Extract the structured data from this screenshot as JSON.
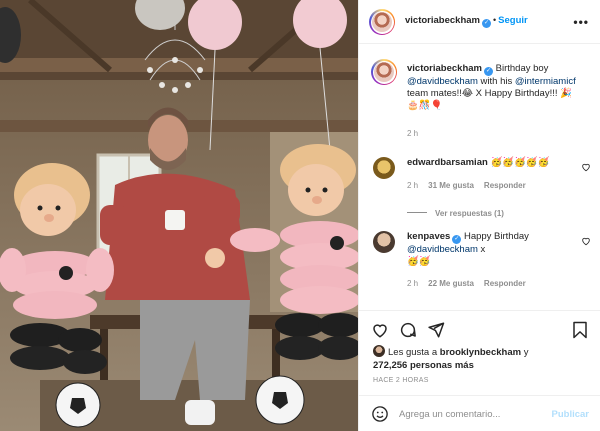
{
  "header": {
    "username": "victoriabeckham",
    "separator": "•",
    "follow_label": "Seguir",
    "more_label": "•••"
  },
  "caption": {
    "username": "victoriabeckham",
    "text_1": "Birthday boy",
    "mention_1": "@davidbeckham",
    "text_2": "with his",
    "mention_2": "@intermiamicf",
    "text_3": "team mates!!😂 X Happy Birthday!!! 🎉🎂🎊🎈",
    "time": "2 h"
  },
  "comments": [
    {
      "username": "edwardbarsamian",
      "text": "🥳🥳🥳🥳🥳",
      "time": "2 h",
      "likes": "31 Me gusta",
      "reply": "Responder",
      "view_replies": "Ver respuestas (1)"
    },
    {
      "username": "kenpaves",
      "text": "Happy Birthday",
      "mention": "@davidbeckham",
      "text_after": "x",
      "text_2": "🥳🥳",
      "time": "2 h",
      "likes": "22 Me gusta",
      "reply": "Responder"
    }
  ],
  "likes": {
    "prefix": "Les gusta a",
    "user": "brooklynbeckham",
    "and": "y",
    "count": "272,256 personas más"
  },
  "timestamp": "HACE 2 HORAS",
  "add_comment": {
    "placeholder": "Agrega un comentario...",
    "publish": "Publicar"
  },
  "icons": {
    "like": "heart-icon",
    "comment": "comment-icon",
    "share": "share-icon",
    "save": "bookmark-icon",
    "emoji": "emoji-icon",
    "verified": "verified-badge-icon"
  },
  "colors": {
    "link": "#00376b",
    "follow": "#0095f6",
    "verified": "#3897f0",
    "muted": "#8e8e8e",
    "publish_disabled": "#b2dffc"
  }
}
